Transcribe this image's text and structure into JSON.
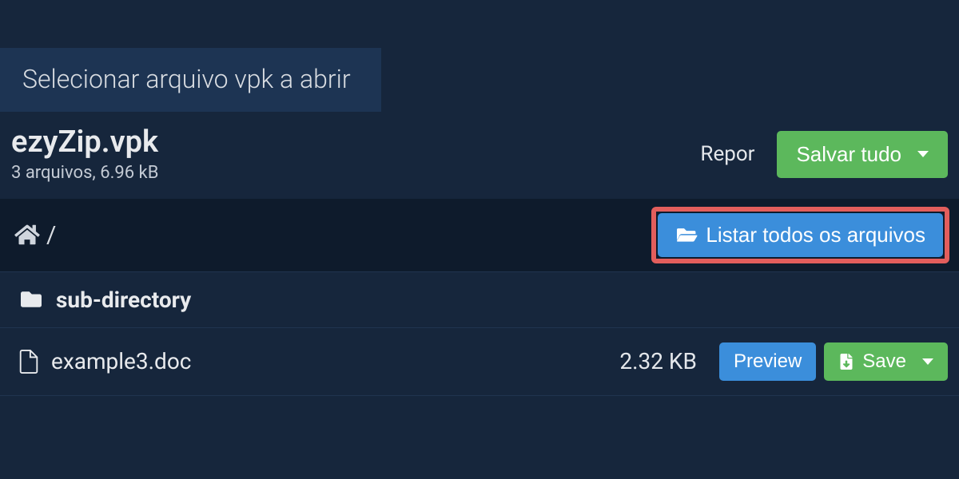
{
  "tab": {
    "label": "Selecionar arquivo vpk a abrir"
  },
  "file": {
    "name": "ezyZip.vpk",
    "stats": "3 arquivos, 6.96 kB"
  },
  "actions": {
    "reset": "Repor",
    "save_all": "Salvar tudo",
    "list_all": "Listar todos os arquivos",
    "preview": "Preview",
    "save": "Save"
  },
  "breadcrumb": {
    "separator": "/"
  },
  "rows": [
    {
      "name": "sub-directory"
    },
    {
      "name": "example3.doc",
      "size": "2.32 KB"
    }
  ]
}
